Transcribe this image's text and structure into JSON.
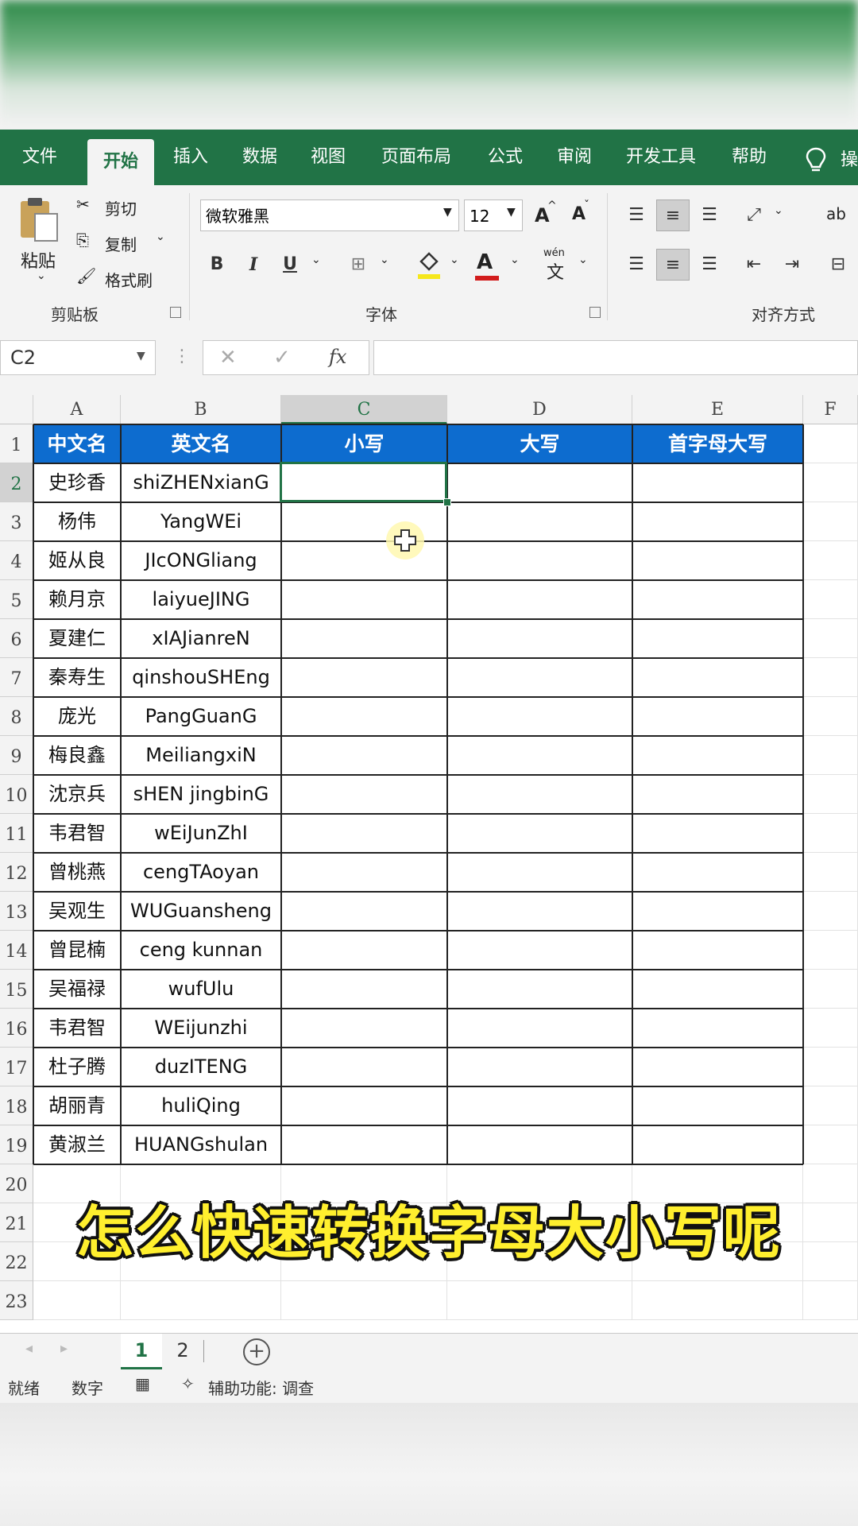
{
  "ribbon_tabs": [
    "文件",
    "开始",
    "插入",
    "数据",
    "视图",
    "页面布局",
    "公式",
    "审阅",
    "开发工具",
    "帮助"
  ],
  "ribbon_tab_active": "开始",
  "ribbon_tab_overflow": "操",
  "clipboard": {
    "paste": "粘贴",
    "cut": "剪切",
    "copy": "复制",
    "format_painter": "格式刷",
    "group": "剪贴板"
  },
  "font": {
    "name": "微软雅黑",
    "size": "12",
    "bold": "B",
    "italic": "I",
    "underline": "U",
    "group": "字体",
    "grow": "A",
    "shrink": "A",
    "color_letter": "A",
    "wen": "wén",
    "wen_char": "文"
  },
  "alignment": {
    "group": "对齐方式",
    "wrap": "ab"
  },
  "name_box": "C2",
  "formula_fx": "fx",
  "columns": [
    "A",
    "B",
    "C",
    "D",
    "E",
    "F"
  ],
  "selected_column": "C",
  "selected_row": 2,
  "table_headers": [
    "中文名",
    "英文名",
    "小写",
    "大写",
    "首字母大写"
  ],
  "table_rows": [
    [
      "史珍香",
      "shiZHENxianG"
    ],
    [
      "杨伟",
      "YangWEi"
    ],
    [
      "姬从良",
      "JIcONGliang"
    ],
    [
      "赖月京",
      "laiyueJING"
    ],
    [
      "夏建仁",
      "xIAJianreN"
    ],
    [
      "秦寿生",
      "qinshouSHEng"
    ],
    [
      "庞光",
      "PangGuanG"
    ],
    [
      "梅良鑫",
      "MeiliangxiN"
    ],
    [
      "沈京兵",
      "sHEN jingbinG"
    ],
    [
      "韦君智",
      "wEiJunZhI"
    ],
    [
      "曾桃燕",
      "cengTAoyan"
    ],
    [
      "吴观生",
      "WUGuansheng"
    ],
    [
      "曾昆楠",
      "ceng kunnan"
    ],
    [
      "吴福禄",
      "wufUlu"
    ],
    [
      "韦君智",
      "WEijunzhi"
    ],
    [
      "杜子腾",
      "duzITENG"
    ],
    [
      "胡丽青",
      "huliQing"
    ],
    [
      "黄淑兰",
      "HUANGshulan"
    ]
  ],
  "row_numbers": [
    "1",
    "2",
    "3",
    "4",
    "5",
    "6",
    "7",
    "8",
    "9",
    "10",
    "11",
    "12",
    "13",
    "14",
    "15",
    "16",
    "17",
    "18",
    "19",
    "20",
    "21",
    "22",
    "23"
  ],
  "subtitle": "怎么快速转换字母大小写呢",
  "sheet_tabs": [
    "1",
    "2"
  ],
  "active_sheet": "1",
  "status_bar": {
    "ready": "就绪",
    "mode": "数字",
    "accessibility": "辅助功能: 调查"
  },
  "colors": {
    "excel_green": "#217346",
    "header_blue": "#0d6ccf",
    "subtitle_yellow": "#ffef2e"
  }
}
